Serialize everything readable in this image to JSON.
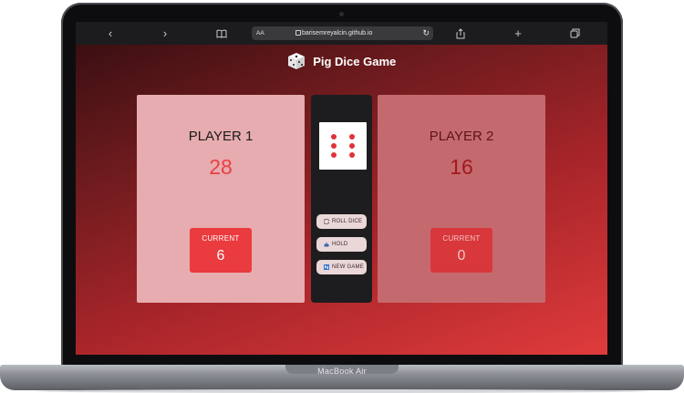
{
  "device": {
    "label": "MacBook Air"
  },
  "browser": {
    "address_prefix": "AA",
    "url": "barisemreyalcin.github.io",
    "reload_glyph": "↻",
    "buttons": {
      "back": "‹",
      "forward": "›",
      "bookmarks": "book-icon",
      "share": "share-icon",
      "new_tab": "+",
      "tabs": "tabs-icon"
    }
  },
  "app": {
    "title": "Pig Dice Game",
    "players": [
      {
        "name": "PLAYER 1",
        "score": "28",
        "current_label": "CURRENT",
        "current": "6",
        "active": true
      },
      {
        "name": "PLAYER 2",
        "score": "16",
        "current_label": "CURRENT",
        "current": "0",
        "active": false
      }
    ],
    "dice_value": 6,
    "buttons": {
      "roll": "ROLL DICE",
      "hold": "HOLD",
      "new_game": "NEW GAME"
    }
  },
  "colors": {
    "accent_red": "#ea3b3f",
    "panel_active": "#e6acaf",
    "panel_inactive": "#c46a6f"
  }
}
